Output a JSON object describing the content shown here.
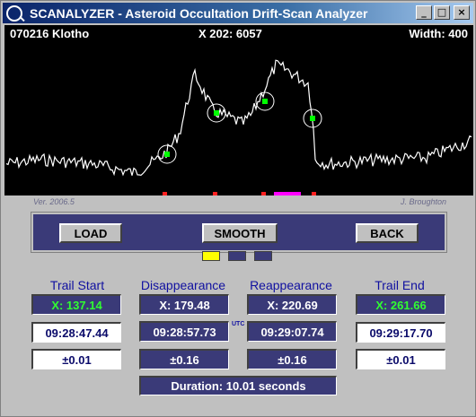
{
  "window": {
    "title": "SCANALYZER - Asteroid Occultation Drift-Scan Analyzer",
    "controls": {
      "minimize": "_",
      "maximize": "□",
      "close": "×"
    }
  },
  "plot": {
    "object": "070216 Klotho",
    "cursor": "X 202: 6057",
    "width": "Width: 400",
    "trace_color": "#ffffff",
    "marker_color": "#00ff00"
  },
  "credits": {
    "version": "Ver. 2006.5",
    "author": "J. Broughton"
  },
  "buttons": {
    "load": "LOAD",
    "smooth": "SMOOTH",
    "back": "BACK"
  },
  "indicators": {
    "colors": [
      "#ffff00",
      "#3a3a78",
      "#3a3a78"
    ]
  },
  "columns": {
    "trail_start": {
      "title": "Trail Start",
      "x": "X:  137.14",
      "time": "09:28:47.44",
      "err": "±0.01"
    },
    "disappearance": {
      "title": "Disappearance",
      "x": "X:  179.48",
      "time": "09:28:57.73",
      "err": "±0.16"
    },
    "reappearance": {
      "title": "Reappearance",
      "x": "X:  220.69",
      "time": "09:29:07.74",
      "err": "±0.16"
    },
    "trail_end": {
      "title": "Trail End",
      "x": "X:  261.66",
      "time": "09:29:17.70",
      "err": "±0.01"
    }
  },
  "utc_label": "UTC",
  "duration": "Duration:  10.01  seconds"
}
